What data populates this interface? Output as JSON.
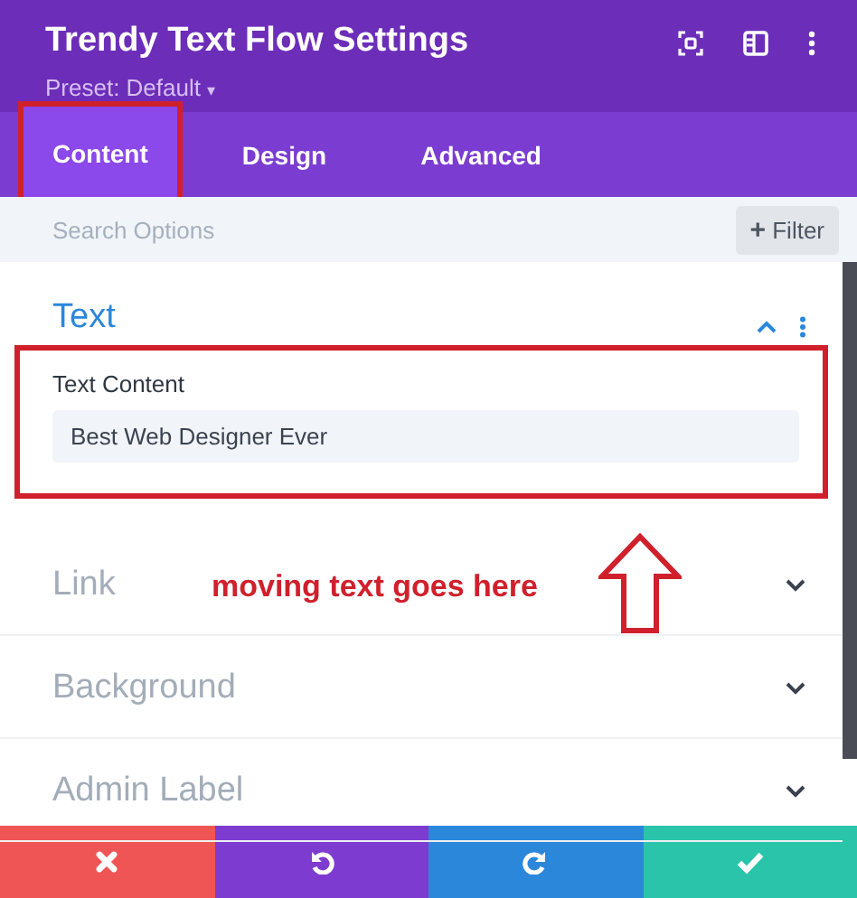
{
  "header": {
    "title": "Trendy Text Flow Settings",
    "preset": "Preset: Default",
    "preset_caret": "▾"
  },
  "tabs": [
    {
      "label": "Content",
      "selected": true,
      "highlighted": true
    },
    {
      "label": "Design",
      "selected": false,
      "highlighted": false
    },
    {
      "label": "Advanced",
      "selected": false,
      "highlighted": false
    }
  ],
  "search": {
    "placeholder": "Search Options",
    "filter_icon": "+",
    "filter_label": "Filter"
  },
  "sections": [
    {
      "title": "Text",
      "expanded": true,
      "highlighted": true,
      "fields": [
        {
          "label": "Text Content",
          "value": "Best Web Designer Ever"
        }
      ]
    },
    {
      "title": "Link",
      "expanded": false,
      "callout": "moving text goes here"
    },
    {
      "title": "Background",
      "expanded": false
    },
    {
      "title": "Admin Label",
      "expanded": false
    }
  ],
  "footer": [
    {
      "kind": "cancel"
    },
    {
      "kind": "undo"
    },
    {
      "kind": "redo"
    },
    {
      "kind": "save"
    }
  ]
}
